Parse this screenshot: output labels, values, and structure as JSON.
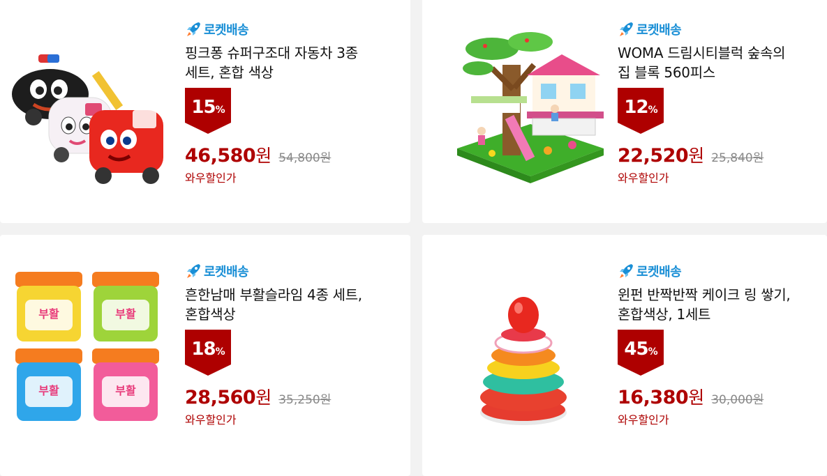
{
  "products": [
    {
      "badge": "로켓배송",
      "title": "핑크퐁 슈퍼구조대 자동차 3종 세트, 혼합 색상",
      "discount_num": "15",
      "discount_pct": "%",
      "sale_price": "46,580",
      "currency": "원",
      "original_price": "54,800원",
      "wow_label": "와우할인가",
      "image": "toy-cars-image"
    },
    {
      "badge": "로켓배송",
      "title": "WOMA 드림시티블럭 숲속의 집 블록 560피스",
      "discount_num": "12",
      "discount_pct": "%",
      "sale_price": "22,520",
      "currency": "원",
      "original_price": "25,840원",
      "wow_label": "와우할인가",
      "image": "treehouse-blocks-image"
    },
    {
      "badge": "로켓배송",
      "title": "흔한남매 부활슬라임 4종 세트, 혼합색상",
      "discount_num": "18",
      "discount_pct": "%",
      "sale_price": "28,560",
      "currency": "원",
      "original_price": "35,250원",
      "wow_label": "와우할인가",
      "image": "slime-jars-image"
    },
    {
      "badge": "로켓배송",
      "title": "윈펀 반짝반짝 케이크 링 쌓기, 혼합색상, 1세트",
      "discount_num": "45",
      "discount_pct": "%",
      "sale_price": "16,380",
      "currency": "원",
      "original_price": "30,000원",
      "wow_label": "와우할인가",
      "image": "stacking-rings-image"
    }
  ],
  "colors": {
    "rocket_blue": "#1a8fd6",
    "price_red": "#ae0000",
    "badge_red": "#ae0000"
  },
  "icons": [
    "rocket-icon"
  ]
}
